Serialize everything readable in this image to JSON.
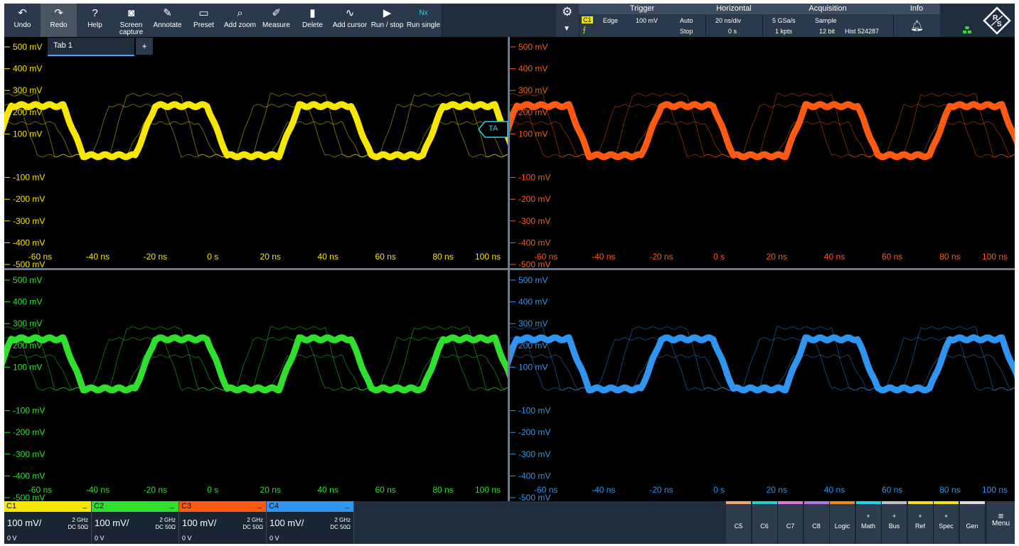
{
  "toolbar": {
    "buttons": [
      {
        "label": "Undo",
        "icon": "undo-icon",
        "glyph": "↶"
      },
      {
        "label": "Redo",
        "icon": "redo-icon",
        "glyph": "↷"
      },
      {
        "label": "Help",
        "icon": "help-icon",
        "glyph": "?"
      },
      {
        "label": "Screen capture",
        "icon": "camera-icon",
        "glyph": "◙"
      },
      {
        "label": "Annotate",
        "icon": "pencil-icon",
        "glyph": "✎"
      },
      {
        "label": "Preset",
        "icon": "preset-icon",
        "glyph": "▭"
      },
      {
        "label": "Add zoom",
        "icon": "zoom-icon",
        "glyph": "⌕"
      },
      {
        "label": "Measure",
        "icon": "ruler-icon",
        "glyph": "✐"
      },
      {
        "label": "Delete",
        "icon": "trash-icon",
        "glyph": "▮"
      },
      {
        "label": "Add cursor",
        "icon": "cursor-icon",
        "glyph": "∿"
      },
      {
        "label": "Run / stop",
        "icon": "play-icon",
        "glyph": "▶"
      },
      {
        "label": "Run single",
        "icon": "single-icon",
        "glyph": "Nx"
      }
    ]
  },
  "status": {
    "trigger": {
      "title": "Trigger",
      "source": "C1",
      "type": "Edge",
      "level": "100 mV",
      "mode": "Auto",
      "state": "Stop"
    },
    "horizontal": {
      "title": "Horizontal",
      "scale": "20 ns/div",
      "position": "0 s"
    },
    "acquisition": {
      "title": "Acquisition",
      "rate": "5 GSa/s",
      "points": "1 kpts",
      "mode": "Sample",
      "bits": "12 bit",
      "hist": "Hist 524287"
    },
    "info": {
      "title": "Info"
    }
  },
  "tab": {
    "label": "Tab 1",
    "add": "+"
  },
  "trigger_marker": "TA",
  "y_labels": [
    "500 mV",
    "400 mV",
    "300 mV",
    "200 mV",
    "100 mV",
    "-100 mV",
    "-200 mV",
    "-300 mV",
    "-400 mV",
    "-500 mV"
  ],
  "x_labels": [
    "-60 ns",
    "-40 ns",
    "-20 ns",
    "0 s",
    "20 ns",
    "40 ns",
    "60 ns",
    "80 ns",
    "100 ns"
  ],
  "colors": {
    "c1": "#f7e600",
    "c2": "#2fe02f",
    "c3": "#ff5a12",
    "c4": "#2f95f0",
    "bg": "#000000",
    "toolbar": "#2a3a4c"
  },
  "chart_data": [
    {
      "type": "line",
      "channel": "C1",
      "color": "#f7e600",
      "x": [
        -80,
        -73,
        -68,
        -50,
        -45,
        -30,
        -25,
        -8,
        -3,
        12,
        17,
        20
      ],
      "y": [
        220,
        220,
        0,
        0,
        220,
        220,
        0,
        0,
        220,
        220,
        0,
        0
      ],
      "xlim": [
        -70,
        100
      ],
      "ylim": [
        -500,
        500
      ],
      "grid": false
    },
    {
      "type": "line",
      "channel": "C3",
      "color": "#ff5a12"
    },
    {
      "type": "line",
      "channel": "C2",
      "color": "#2fe02f"
    },
    {
      "type": "line",
      "channel": "C4",
      "color": "#2f95f0"
    }
  ],
  "channels": [
    {
      "name": "C1",
      "scale": "100 mV/",
      "bw": "2 GHz",
      "coupling": "DC 50Ω",
      "offset": "0 V",
      "color": "#f7e600"
    },
    {
      "name": "C2",
      "scale": "100 mV/",
      "bw": "2 GHz",
      "coupling": "DC 50Ω",
      "offset": "0 V",
      "color": "#2fe02f"
    },
    {
      "name": "C3",
      "scale": "100 mV/",
      "bw": "2 GHz",
      "coupling": "DC 50Ω",
      "offset": "0 V",
      "color": "#ff5a12"
    },
    {
      "name": "C4",
      "scale": "100 mV/",
      "bw": "2 GHz",
      "coupling": "DC 50Ω",
      "offset": "0 V",
      "color": "#2f95f0"
    }
  ],
  "right_buttons": [
    {
      "label": "C5",
      "plus": "",
      "color": "#f2a57a"
    },
    {
      "label": "C6",
      "plus": "",
      "color": "#27d0c8"
    },
    {
      "label": "C7",
      "plus": "",
      "color": "#e07ad8"
    },
    {
      "label": "C8",
      "plus": "",
      "color": "#b07ae0"
    },
    {
      "label": "Logic",
      "plus": "",
      "color": "#e88a2a"
    },
    {
      "label": "Math",
      "plus": "+",
      "color": "#2ad0e8"
    },
    {
      "label": "Bus",
      "plus": "+",
      "color": "#c0c0c0"
    },
    {
      "label": "Ref",
      "plus": "+",
      "color": "#f0e020"
    },
    {
      "label": "Spec",
      "plus": "+",
      "color": "#f0e020"
    },
    {
      "label": "Gen",
      "plus": "",
      "color": "#dddddd"
    }
  ],
  "menu_label": "Menu"
}
